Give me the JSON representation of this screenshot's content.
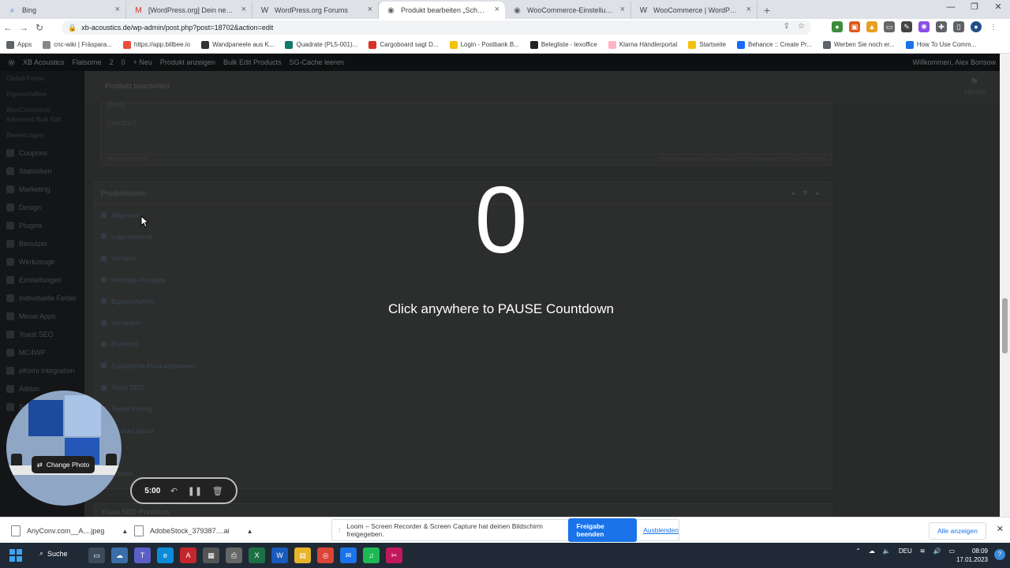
{
  "browser": {
    "tabs": [
      {
        "label": "Bing",
        "icon": "bing-icon",
        "icon_char": "⌕",
        "icon_color": "#1a73e8"
      },
      {
        "label": "[WordPress.org] Dein neues Kon",
        "icon": "gmail-icon",
        "icon_char": "M",
        "icon_color": "#d93025"
      },
      {
        "label": "WordPress.org Forums",
        "icon": "wordpress-icon",
        "icon_char": "W",
        "icon_color": "#3c4043"
      },
      {
        "label": "Produkt bearbeiten „Schallabsor",
        "icon": "loom-recording-icon",
        "icon_char": "◉",
        "icon_color": "#5f6368"
      },
      {
        "label": "WooCommerce-Einstellungen ‹ X",
        "icon": "loom-recording-icon",
        "icon_char": "◉",
        "icon_color": "#5f6368"
      },
      {
        "label": "WooCommerce | WordPress.org",
        "icon": "wordpress-icon",
        "icon_char": "W",
        "icon_color": "#3c4043"
      }
    ],
    "active_tab_index": 3,
    "url": "xb-acoustics.de/wp-admin/post.php?post=18702&action=edit",
    "bookmarks": [
      {
        "label": "Apps",
        "color": "#5f6368"
      },
      {
        "label": "cnc-wiki | Fräspara...",
        "color": "#888888"
      },
      {
        "label": "https://app.billbee.io",
        "color": "#e94e3c"
      },
      {
        "label": "Wandpaneele aus K...",
        "color": "#333333"
      },
      {
        "label": "Quadrate (PL5-001)...",
        "color": "#0f7a6a"
      },
      {
        "label": "Cargoboard sagt D...",
        "color": "#d93025"
      },
      {
        "label": "Login - Postbank B...",
        "color": "#f4c20d"
      },
      {
        "label": "Belegliste - lexoffice",
        "color": "#222222"
      },
      {
        "label": "Klarna Händlerportal",
        "color": "#ffb3c7"
      },
      {
        "label": "Startseite",
        "color": "#f4c20d"
      },
      {
        "label": "Behance :: Create Pr...",
        "color": "#1769ff"
      },
      {
        "label": "Werben Sie noch er...",
        "color": "#5f6368"
      },
      {
        "label": "How To Use Comm...",
        "color": "#1a73e8"
      }
    ]
  },
  "adminbar": {
    "items": [
      "XB Acoustics",
      "Flatsome",
      "2",
      "0",
      "+ Neu",
      "Produkt anzeigen",
      "Bulk Edit Products",
      "SG-Cache leeren"
    ],
    "greeting": "Willkommen, Alex Borisow"
  },
  "sidebar": {
    "subitems": [
      "Global Forms",
      "Eigenschaften",
      "WooCommerce Advanced Bulk Edit",
      "Bewertungen"
    ],
    "menu": [
      "Coupons",
      "Statistiken",
      "Marketing",
      "Design",
      "Plugins",
      "Benutzer",
      "Werkzeuge",
      "Einstellungen",
      "Individuelle Felder",
      "Meow Apps",
      "Yoast SEO",
      "MC4WP",
      "eKomi Integration"
    ],
    "bottom": [
      "Addon",
      "Settings"
    ]
  },
  "page": {
    "title": "Produkt bearbeiten",
    "aktualisieren": "Aktualis",
    "code_lines": [
      "[/row]",
      "[/section]"
    ],
    "wordcount": "Wortanzahl: 460",
    "last_edit": "Zuletzt geändert von sheman am 22. November 2022 um 13:06 Uhr",
    "product_data_title": "Produktdaten",
    "product_tabs": [
      "Allgemein",
      "Lagerbestand",
      "Versand",
      "Verlinkte Produkte",
      "Eigenschaften",
      "Varianten",
      "Erweitert",
      "Zusätzliche Produktoptionen",
      "Yoast SEO",
      "Tiered Pricing",
      "Product layout",
      "...",
      "...tches"
    ],
    "yoast_box_title": "Yoast SEO Premium"
  },
  "countdown": {
    "value": "0",
    "message": "Click anywhere to PAUSE Countdown"
  },
  "loom": {
    "change_photo": "Change Photo",
    "timer": "5:00"
  },
  "downloads": {
    "items": [
      "AnyConv.com__A....jpeg",
      "AdobeStock_379387....ai"
    ],
    "share_message": "Loom – Screen Recorder & Screen Capture hat deinen Bildschirm freigegeben.",
    "stop_label": "Freigabe beenden",
    "hide_label": "Ausblenden",
    "show_all": "Alle anzeigen"
  },
  "taskbar": {
    "search_label": "Suche",
    "language": "DEU",
    "time": "08:09",
    "date": "17.01.2023",
    "apps": [
      {
        "name": "task-view",
        "color": "#3b4a5a",
        "char": "▭"
      },
      {
        "name": "weather",
        "color": "#3b6ea8",
        "char": "☁"
      },
      {
        "name": "teams",
        "color": "#5b5fc7",
        "char": "T"
      },
      {
        "name": "edge",
        "color": "#0c8cd8",
        "char": "e"
      },
      {
        "name": "acrobat",
        "color": "#c4262e",
        "char": "A"
      },
      {
        "name": "calculator",
        "color": "#555555",
        "char": "▦"
      },
      {
        "name": "printer",
        "color": "#666666",
        "char": "⎙"
      },
      {
        "name": "excel",
        "color": "#1d7044",
        "char": "X"
      },
      {
        "name": "word",
        "color": "#185abd",
        "char": "W"
      },
      {
        "name": "explorer",
        "color": "#e8b42a",
        "char": "▤"
      },
      {
        "name": "chrome",
        "color": "#db4437",
        "char": "◎"
      },
      {
        "name": "mail",
        "color": "#1a73e8",
        "char": "✉"
      },
      {
        "name": "spotify",
        "color": "#1db954",
        "char": "♫"
      },
      {
        "name": "snipping",
        "color": "#c2185b",
        "char": "✂"
      }
    ]
  }
}
